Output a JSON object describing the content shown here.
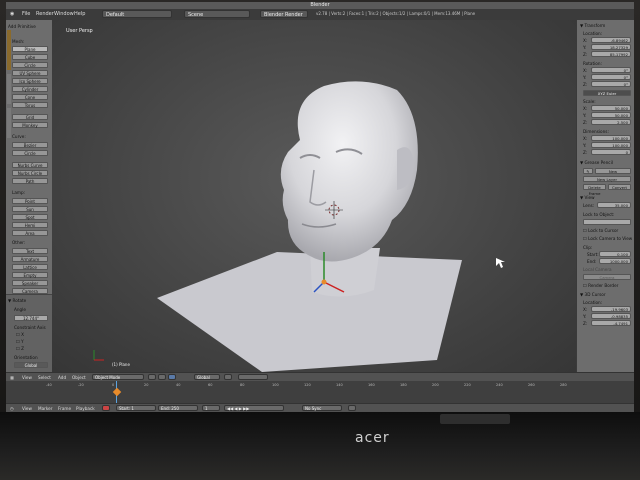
{
  "window": {
    "title": "Blender"
  },
  "menu": [
    "File",
    "Render",
    "Window",
    "Help"
  ],
  "screen_layout": "Default",
  "scene": "Scene",
  "engine": "Blender Render",
  "status_text": "v2.78 | Verts:2 | Faces:1 | Tris:2 | Objects:1/2 | Lamps:0/1 | Mem:13.46M | Plane",
  "toolbar": {
    "header": "Add Primitive",
    "mesh_label": "Mesh:",
    "mesh": [
      "Plane",
      "Cube",
      "Circle",
      "UV Sphere",
      "Ico Sphere",
      "Cylinder",
      "Cone",
      "Torus"
    ],
    "grid": [
      "Grid",
      "Monkey"
    ],
    "curve_label": "Curve:",
    "curve": [
      "Bezier",
      "Circle",
      "Nurbs Curve",
      "Nurbs Circle",
      "Path"
    ],
    "lamp_label": "Lamp:",
    "lamp": [
      "Point",
      "Sun",
      "Spot",
      "Hemi",
      "Area"
    ],
    "other_label": "Other:",
    "other": [
      "Text",
      "Armature",
      "Lattice",
      "Empty",
      "Speaker",
      "Camera"
    ],
    "rotate": {
      "header": "▼ Rotate",
      "angle_label": "Angle",
      "angle_value": "12.744°",
      "constraint_label": "Constraint Axis",
      "axes": [
        "X",
        "Y",
        "Z"
      ],
      "orientation_label": "Orientation",
      "orientation_value": "Global"
    }
  },
  "viewport": {
    "label": "User Persp",
    "object_label": "(1) Plane"
  },
  "properties": {
    "transform_header": "▼ Transform",
    "location_label": "Location:",
    "location": [
      {
        "axis": "X:",
        "value": "-6.89462"
      },
      {
        "axis": "Y:",
        "value": "18.27329"
      },
      {
        "axis": "Z:",
        "value": "85.17992"
      }
    ],
    "rotation_label": "Rotation:",
    "rotation": [
      {
        "axis": "X:",
        "value": "0°"
      },
      {
        "axis": "Y:",
        "value": "0°"
      },
      {
        "axis": "Z:",
        "value": "0°"
      }
    ],
    "rotation_mode": "XYZ Euler",
    "scale_label": "Scale:",
    "scale": [
      {
        "axis": "X:",
        "value": "50.000"
      },
      {
        "axis": "Y:",
        "value": "50.000"
      },
      {
        "axis": "Z:",
        "value": "2.500"
      }
    ],
    "dimensions_label": "Dimensions:",
    "dimensions": [
      {
        "axis": "X:",
        "value": "100.000"
      },
      {
        "axis": "Y:",
        "value": "100.000"
      },
      {
        "axis": "Z:",
        "value": "0"
      }
    ],
    "grease_header": "▼ Grease Pencil",
    "grease_new": "New",
    "grease_new_layer": "New Layer",
    "grease_buttons": [
      "Delete Frame",
      "Convert"
    ],
    "view_header": "▼ View",
    "lens_label": "Lens:",
    "lens_value": "35.000",
    "lock_object_label": "Lock to Object:",
    "lock_cursor": "Lock to Cursor",
    "lock_camera": "Lock Camera to View",
    "clip_label": "Clip:",
    "clip_start_label": "Start:",
    "clip_start": "0.100",
    "clip_end_label": "End:",
    "clip_end": "1000.000",
    "local_camera": "Local Camera",
    "camera_field": "Camera",
    "render_border": "Render Border",
    "cursor_header": "▼ 3D Cursor",
    "cursor_location_label": "Location:",
    "cursor": [
      {
        "axis": "X:",
        "value": "-19.9603"
      },
      {
        "axis": "Y:",
        "value": "-0.98835"
      },
      {
        "axis": "Z:",
        "value": "-4.7491"
      }
    ]
  },
  "view_header": {
    "items": [
      "View",
      "Select",
      "Add",
      "Object"
    ],
    "mode": "Object Mode",
    "pivot": "Global"
  },
  "timeline": {
    "ticks": [
      "-40",
      "-20",
      "0",
      "20",
      "40",
      "60",
      "80",
      "100",
      "120",
      "140",
      "160",
      "180",
      "200",
      "220",
      "240",
      "260",
      "280"
    ],
    "header": [
      "View",
      "Marker",
      "Frame",
      "Playback"
    ],
    "start_label": "Start:",
    "start_value": "1",
    "end_label": "End:",
    "end_value": "250",
    "current_frame": "1",
    "sync": "No Sync"
  },
  "monitor": {
    "brand": "acer"
  },
  "colors": {
    "accent_orange": "#e88b2a",
    "selected_blue": "#5a7aa8",
    "mesh": "#d9d9dd"
  }
}
